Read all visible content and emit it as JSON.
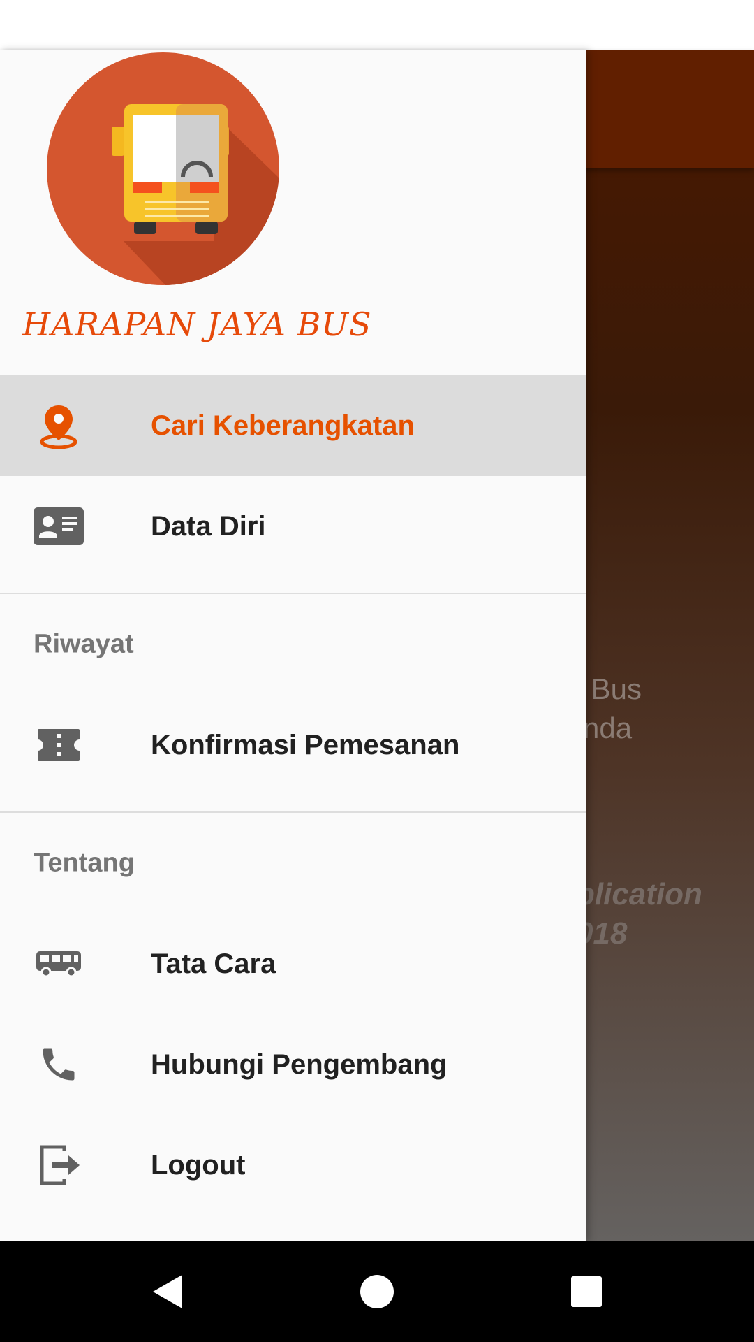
{
  "app": {
    "brand": "HARAPAN JAYA BUS"
  },
  "colors": {
    "accent": "#e65100",
    "drawer_bg": "#fafafa",
    "active_bg": "#dcdcdc",
    "toolbar_bg": "#611f00"
  },
  "background": {
    "partial_text_1": " Bus\nnda",
    "partial_text_2": "plication\n018"
  },
  "menu": {
    "primary": [
      {
        "label": "Cari Keberangkatan",
        "icon": "location-pin-icon",
        "active": true
      },
      {
        "label": "Data Diri",
        "icon": "id-card-icon",
        "active": false
      }
    ],
    "riwayat_header": "Riwayat",
    "riwayat": [
      {
        "label": "Konfirmasi Pemesanan",
        "icon": "ticket-icon"
      }
    ],
    "tentang_header": "Tentang",
    "tentang": [
      {
        "label": "Tata Cara",
        "icon": "bus-icon"
      },
      {
        "label": "Hubungi Pengembang",
        "icon": "phone-icon"
      },
      {
        "label": "Logout",
        "icon": "logout-icon"
      }
    ]
  },
  "nav": {
    "back": "back-icon",
    "home": "home-icon",
    "recents": "recents-icon"
  }
}
